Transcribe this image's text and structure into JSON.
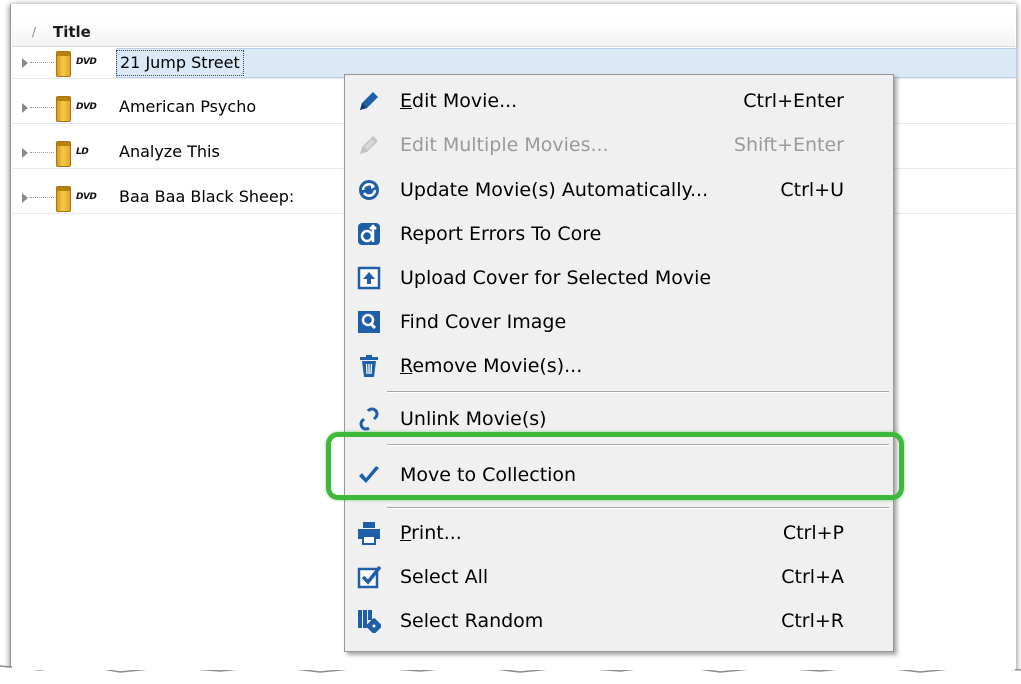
{
  "header": {
    "sort_indicator": "/",
    "column_title": "Title"
  },
  "rows": [
    {
      "title": "21 Jump Street",
      "format": "DVD"
    },
    {
      "title": "American Psycho",
      "format": "DVD"
    },
    {
      "title": "Analyze This",
      "format": "LD"
    },
    {
      "title": "Baa Baa Black Sheep:",
      "format": "DVD"
    }
  ],
  "menu": {
    "items": [
      {
        "label": "Edit Movie...",
        "accel": "E",
        "rest": "dit Movie...",
        "shortcut": "Ctrl+Enter",
        "icon": "pencil-icon",
        "enabled": true
      },
      {
        "label": "Edit Multiple Movies...",
        "shortcut": "Shift+Enter",
        "icon": "pencil-icon",
        "enabled": false
      },
      {
        "label": "Update Movie(s) Automatically...",
        "shortcut": "Ctrl+U",
        "icon": "update-icon",
        "enabled": true
      },
      {
        "label": "Report Errors To Core",
        "shortcut": "",
        "icon": "report-icon",
        "enabled": true
      },
      {
        "label": "Upload Cover for Selected Movie",
        "shortcut": "",
        "icon": "upload-icon",
        "enabled": true
      },
      {
        "label": "Find Cover Image",
        "shortcut": "",
        "icon": "magnifier-icon",
        "enabled": true
      },
      {
        "label": "Remove Movie(s)...",
        "accel": "R",
        "rest": "emove Movie(s)...",
        "shortcut": "",
        "icon": "trash-icon",
        "enabled": true
      },
      {
        "label": "Unlink Movie(s)",
        "shortcut": "",
        "icon": "unlink-icon",
        "enabled": true
      },
      {
        "label": "Move to Collection",
        "shortcut": "",
        "icon": "checkmark-icon",
        "enabled": true
      },
      {
        "label": "Print...",
        "accel": "P",
        "rest": "rint...",
        "shortcut": "Ctrl+P",
        "icon": "printer-icon",
        "enabled": true
      },
      {
        "label": "Select All",
        "shortcut": "Ctrl+A",
        "icon": "checkbox-icon",
        "enabled": true
      },
      {
        "label": "Select Random",
        "shortcut": "Ctrl+R",
        "icon": "dice-icon",
        "enabled": true
      }
    ]
  },
  "colors": {
    "highlight_ring": "#3db83a",
    "icon_blue": "#1f5fa8",
    "selection": "#dbe8f6"
  }
}
